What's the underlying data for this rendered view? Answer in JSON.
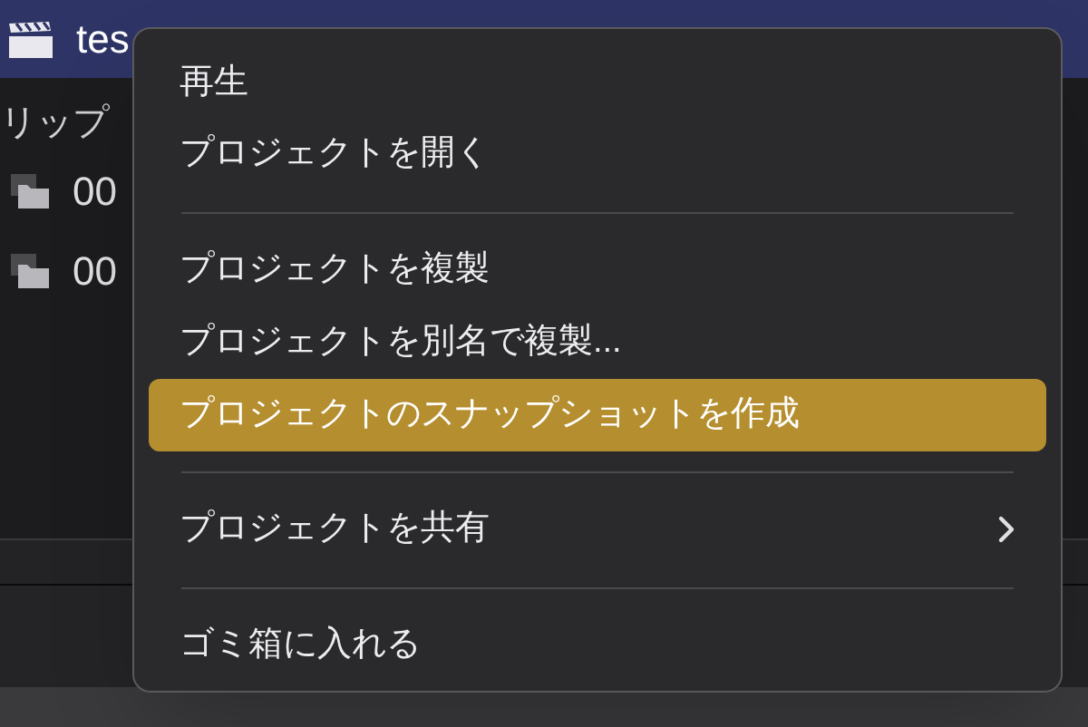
{
  "header": {
    "title": "tes"
  },
  "sidebar": {
    "heading": "リップ",
    "items": [
      {
        "label": "00"
      },
      {
        "label": "00"
      }
    ]
  },
  "menu": {
    "items": [
      {
        "kind": "item",
        "label": "再生",
        "selected": false,
        "submenu": false
      },
      {
        "kind": "item",
        "label": "プロジェクトを開く",
        "selected": false,
        "submenu": false
      },
      {
        "kind": "separator"
      },
      {
        "kind": "item",
        "label": "プロジェクトを複製",
        "selected": false,
        "submenu": false
      },
      {
        "kind": "item",
        "label": "プロジェクトを別名で複製...",
        "selected": false,
        "submenu": false
      },
      {
        "kind": "item",
        "label": "プロジェクトのスナップショットを作成",
        "selected": true,
        "submenu": false
      },
      {
        "kind": "separator"
      },
      {
        "kind": "item",
        "label": "プロジェクトを共有",
        "selected": false,
        "submenu": true
      },
      {
        "kind": "separator"
      },
      {
        "kind": "item",
        "label": "ゴミ箱に入れる",
        "selected": false,
        "submenu": false
      }
    ]
  }
}
